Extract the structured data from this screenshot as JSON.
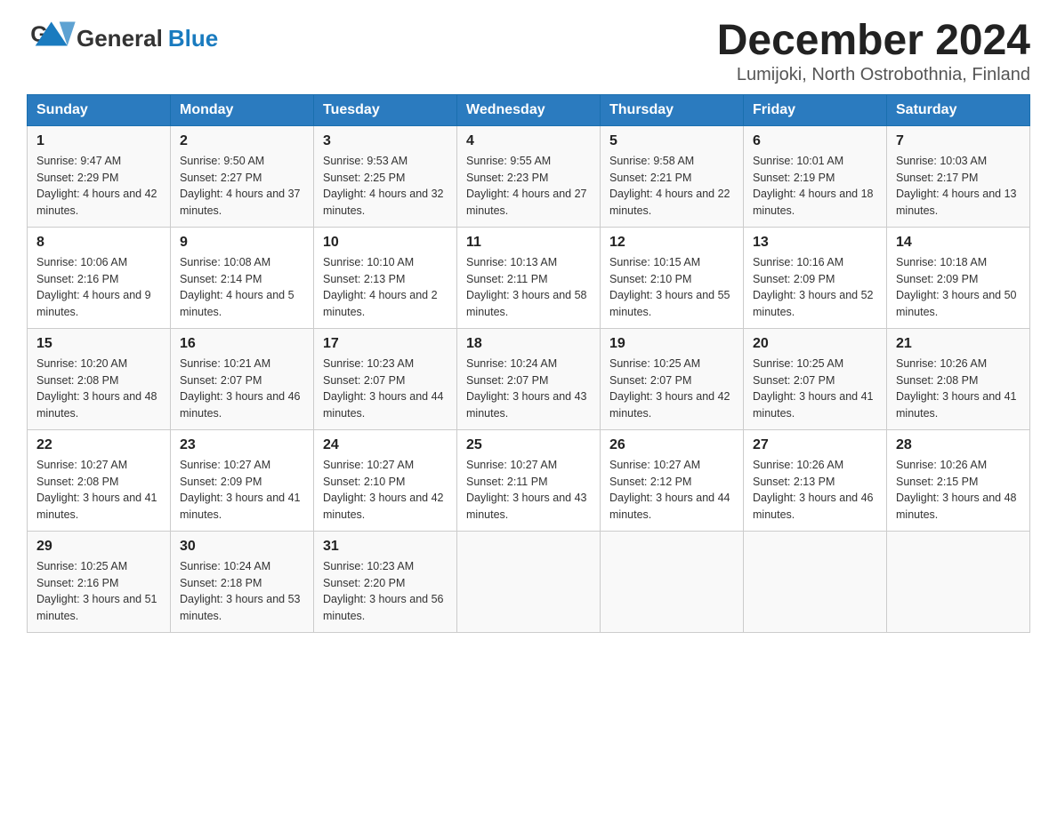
{
  "header": {
    "logo_general": "General",
    "logo_blue": "Blue",
    "title": "December 2024",
    "subtitle": "Lumijoki, North Ostrobothnia, Finland"
  },
  "calendar": {
    "days_of_week": [
      "Sunday",
      "Monday",
      "Tuesday",
      "Wednesday",
      "Thursday",
      "Friday",
      "Saturday"
    ],
    "weeks": [
      [
        {
          "day": "1",
          "sunrise": "Sunrise: 9:47 AM",
          "sunset": "Sunset: 2:29 PM",
          "daylight": "Daylight: 4 hours and 42 minutes."
        },
        {
          "day": "2",
          "sunrise": "Sunrise: 9:50 AM",
          "sunset": "Sunset: 2:27 PM",
          "daylight": "Daylight: 4 hours and 37 minutes."
        },
        {
          "day": "3",
          "sunrise": "Sunrise: 9:53 AM",
          "sunset": "Sunset: 2:25 PM",
          "daylight": "Daylight: 4 hours and 32 minutes."
        },
        {
          "day": "4",
          "sunrise": "Sunrise: 9:55 AM",
          "sunset": "Sunset: 2:23 PM",
          "daylight": "Daylight: 4 hours and 27 minutes."
        },
        {
          "day": "5",
          "sunrise": "Sunrise: 9:58 AM",
          "sunset": "Sunset: 2:21 PM",
          "daylight": "Daylight: 4 hours and 22 minutes."
        },
        {
          "day": "6",
          "sunrise": "Sunrise: 10:01 AM",
          "sunset": "Sunset: 2:19 PM",
          "daylight": "Daylight: 4 hours and 18 minutes."
        },
        {
          "day": "7",
          "sunrise": "Sunrise: 10:03 AM",
          "sunset": "Sunset: 2:17 PM",
          "daylight": "Daylight: 4 hours and 13 minutes."
        }
      ],
      [
        {
          "day": "8",
          "sunrise": "Sunrise: 10:06 AM",
          "sunset": "Sunset: 2:16 PM",
          "daylight": "Daylight: 4 hours and 9 minutes."
        },
        {
          "day": "9",
          "sunrise": "Sunrise: 10:08 AM",
          "sunset": "Sunset: 2:14 PM",
          "daylight": "Daylight: 4 hours and 5 minutes."
        },
        {
          "day": "10",
          "sunrise": "Sunrise: 10:10 AM",
          "sunset": "Sunset: 2:13 PM",
          "daylight": "Daylight: 4 hours and 2 minutes."
        },
        {
          "day": "11",
          "sunrise": "Sunrise: 10:13 AM",
          "sunset": "Sunset: 2:11 PM",
          "daylight": "Daylight: 3 hours and 58 minutes."
        },
        {
          "day": "12",
          "sunrise": "Sunrise: 10:15 AM",
          "sunset": "Sunset: 2:10 PM",
          "daylight": "Daylight: 3 hours and 55 minutes."
        },
        {
          "day": "13",
          "sunrise": "Sunrise: 10:16 AM",
          "sunset": "Sunset: 2:09 PM",
          "daylight": "Daylight: 3 hours and 52 minutes."
        },
        {
          "day": "14",
          "sunrise": "Sunrise: 10:18 AM",
          "sunset": "Sunset: 2:09 PM",
          "daylight": "Daylight: 3 hours and 50 minutes."
        }
      ],
      [
        {
          "day": "15",
          "sunrise": "Sunrise: 10:20 AM",
          "sunset": "Sunset: 2:08 PM",
          "daylight": "Daylight: 3 hours and 48 minutes."
        },
        {
          "day": "16",
          "sunrise": "Sunrise: 10:21 AM",
          "sunset": "Sunset: 2:07 PM",
          "daylight": "Daylight: 3 hours and 46 minutes."
        },
        {
          "day": "17",
          "sunrise": "Sunrise: 10:23 AM",
          "sunset": "Sunset: 2:07 PM",
          "daylight": "Daylight: 3 hours and 44 minutes."
        },
        {
          "day": "18",
          "sunrise": "Sunrise: 10:24 AM",
          "sunset": "Sunset: 2:07 PM",
          "daylight": "Daylight: 3 hours and 43 minutes."
        },
        {
          "day": "19",
          "sunrise": "Sunrise: 10:25 AM",
          "sunset": "Sunset: 2:07 PM",
          "daylight": "Daylight: 3 hours and 42 minutes."
        },
        {
          "day": "20",
          "sunrise": "Sunrise: 10:25 AM",
          "sunset": "Sunset: 2:07 PM",
          "daylight": "Daylight: 3 hours and 41 minutes."
        },
        {
          "day": "21",
          "sunrise": "Sunrise: 10:26 AM",
          "sunset": "Sunset: 2:08 PM",
          "daylight": "Daylight: 3 hours and 41 minutes."
        }
      ],
      [
        {
          "day": "22",
          "sunrise": "Sunrise: 10:27 AM",
          "sunset": "Sunset: 2:08 PM",
          "daylight": "Daylight: 3 hours and 41 minutes."
        },
        {
          "day": "23",
          "sunrise": "Sunrise: 10:27 AM",
          "sunset": "Sunset: 2:09 PM",
          "daylight": "Daylight: 3 hours and 41 minutes."
        },
        {
          "day": "24",
          "sunrise": "Sunrise: 10:27 AM",
          "sunset": "Sunset: 2:10 PM",
          "daylight": "Daylight: 3 hours and 42 minutes."
        },
        {
          "day": "25",
          "sunrise": "Sunrise: 10:27 AM",
          "sunset": "Sunset: 2:11 PM",
          "daylight": "Daylight: 3 hours and 43 minutes."
        },
        {
          "day": "26",
          "sunrise": "Sunrise: 10:27 AM",
          "sunset": "Sunset: 2:12 PM",
          "daylight": "Daylight: 3 hours and 44 minutes."
        },
        {
          "day": "27",
          "sunrise": "Sunrise: 10:26 AM",
          "sunset": "Sunset: 2:13 PM",
          "daylight": "Daylight: 3 hours and 46 minutes."
        },
        {
          "day": "28",
          "sunrise": "Sunrise: 10:26 AM",
          "sunset": "Sunset: 2:15 PM",
          "daylight": "Daylight: 3 hours and 48 minutes."
        }
      ],
      [
        {
          "day": "29",
          "sunrise": "Sunrise: 10:25 AM",
          "sunset": "Sunset: 2:16 PM",
          "daylight": "Daylight: 3 hours and 51 minutes."
        },
        {
          "day": "30",
          "sunrise": "Sunrise: 10:24 AM",
          "sunset": "Sunset: 2:18 PM",
          "daylight": "Daylight: 3 hours and 53 minutes."
        },
        {
          "day": "31",
          "sunrise": "Sunrise: 10:23 AM",
          "sunset": "Sunset: 2:20 PM",
          "daylight": "Daylight: 3 hours and 56 minutes."
        },
        {
          "day": "",
          "sunrise": "",
          "sunset": "",
          "daylight": ""
        },
        {
          "day": "",
          "sunrise": "",
          "sunset": "",
          "daylight": ""
        },
        {
          "day": "",
          "sunrise": "",
          "sunset": "",
          "daylight": ""
        },
        {
          "day": "",
          "sunrise": "",
          "sunset": "",
          "daylight": ""
        }
      ]
    ]
  }
}
